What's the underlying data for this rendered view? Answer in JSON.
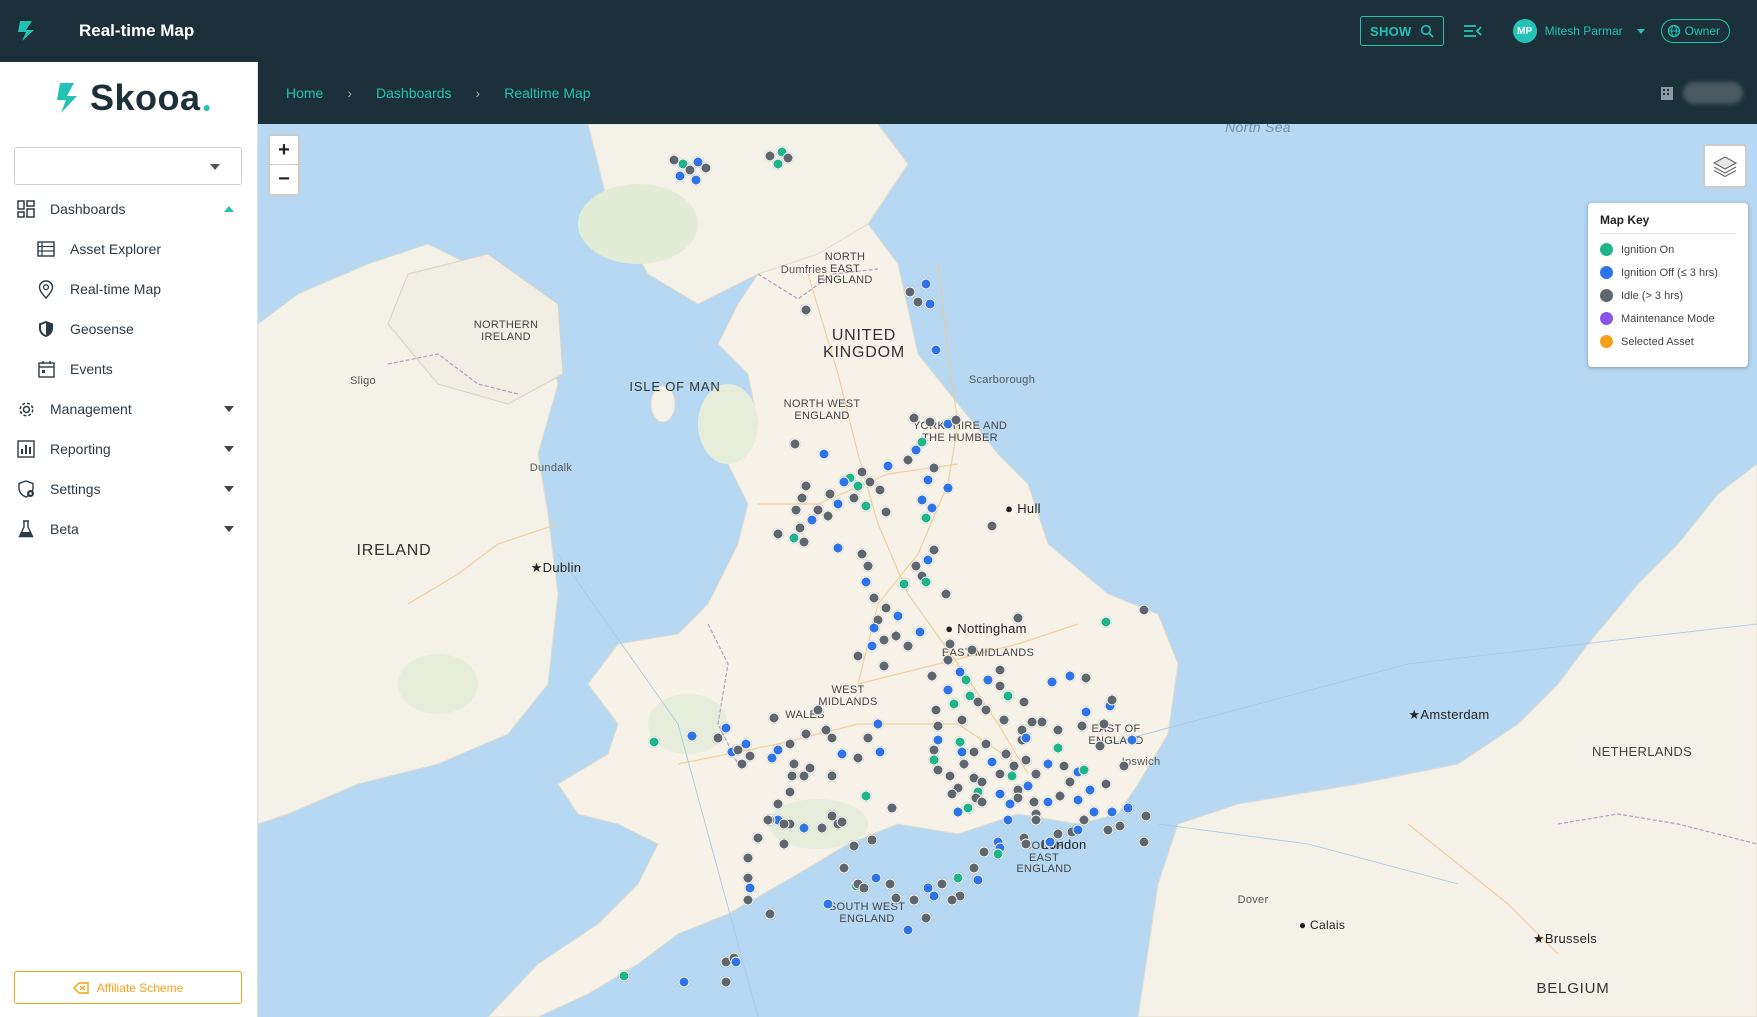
{
  "app": {
    "title": "Real-time Map"
  },
  "topbar": {
    "show_label": "SHOW",
    "user_initials": "MP",
    "user_name": "Mitesh Parmar",
    "role": "Owner"
  },
  "brand": {
    "name": "Skooa"
  },
  "sidebar": {
    "items": [
      {
        "label": "Dashboards"
      },
      {
        "label": "Asset Explorer"
      },
      {
        "label": "Real-time Map"
      },
      {
        "label": "Geosense"
      },
      {
        "label": "Events"
      },
      {
        "label": "Management"
      },
      {
        "label": "Reporting"
      },
      {
        "label": "Settings"
      },
      {
        "label": "Beta"
      }
    ],
    "affiliate_label": "Affiliate Scheme"
  },
  "breadcrumb": {
    "home": "Home",
    "dashboards": "Dashboards",
    "current": "Realtime Map"
  },
  "map": {
    "zoom_in": "+",
    "zoom_out": "−",
    "labels": {
      "north_sea": "North Sea",
      "dumfries": "Dumfries",
      "north_east_england": "NORTH EAST ENGLAND",
      "united_kingdom": "UNITED KINGDOM",
      "northern_ireland": "NORTHERN IRELAND",
      "sligo": "Sligo",
      "isle_of_man": "ISLE OF MAN",
      "scarborough": "Scarborough",
      "north_west_england": "NORTH WEST ENGLAND",
      "yorkshire": "YORKSHIRE AND THE HUMBER",
      "dundalk": "Dundalk",
      "hull": "Hull",
      "ireland": "IRELAND",
      "dublin": "Dublin",
      "nottingham": "Nottingham",
      "east_midlands": "EAST MIDLANDS",
      "west_midlands": "WEST MIDLANDS",
      "wales": "WALES",
      "east_of_england": "EAST OF ENGLAND",
      "ipswich": "Ipswich",
      "amsterdam": "Amsterdam",
      "netherlands": "NETHERLANDS",
      "london": "London",
      "south_east_england": "SOUTH EAST ENGLAND",
      "south_west_england": "SOUTH WEST ENGLAND",
      "dover": "Dover",
      "calais": "Calais",
      "brussels": "Brussels",
      "belgium": "BELGIUM"
    }
  },
  "legend": {
    "title": "Map Key",
    "items": [
      {
        "label": "Ignition On",
        "color": "#1fb589"
      },
      {
        "label": "Ignition Off (≤ 3 hrs)",
        "color": "#2f73e8"
      },
      {
        "label": "Idle (> 3 hrs)",
        "color": "#5f666d"
      },
      {
        "label": "Maintenance Mode",
        "color": "#8a55e6"
      },
      {
        "label": "Selected Asset",
        "color": "#f5a21b"
      }
    ]
  }
}
